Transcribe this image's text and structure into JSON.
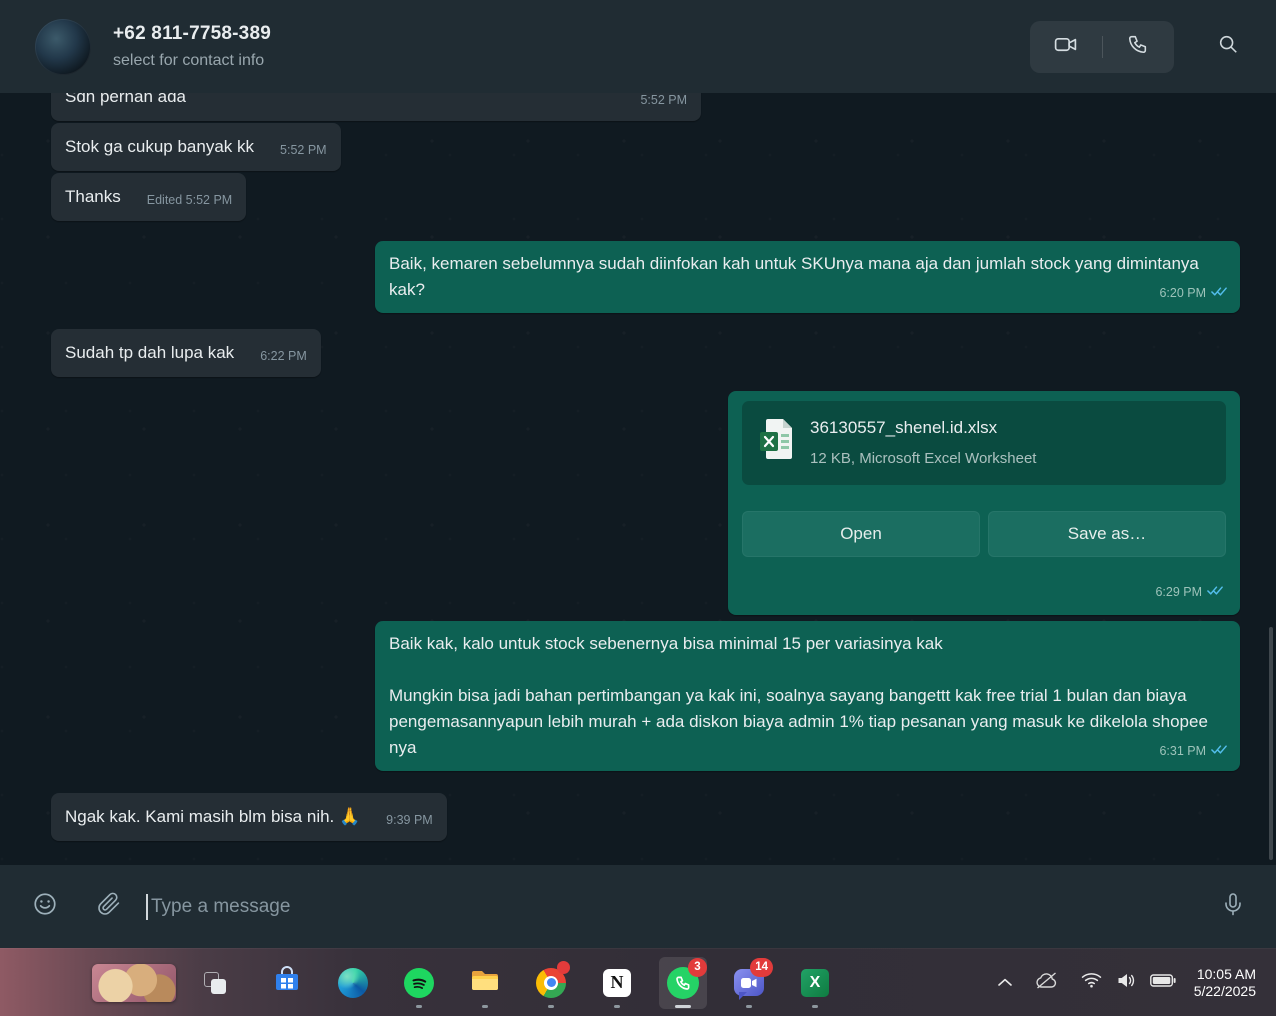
{
  "header": {
    "title": "+62 811-7758-389",
    "subtitle": "select for contact info"
  },
  "messages": [
    {
      "type": "in",
      "text": "Sdh pernah ada",
      "time": "5:52 PM"
    },
    {
      "type": "in",
      "text": "Stok ga cukup banyak kk",
      "time": "5:52 PM"
    },
    {
      "type": "in",
      "text": "Thanks",
      "meta": "Edited 5:52 PM"
    },
    {
      "type": "out",
      "text": "Baik, kemaren sebelumnya sudah diinfokan kah untuk SKUnya mana aja dan jumlah stock yang dimintanya kak?",
      "time": "6:20 PM",
      "status": "read"
    },
    {
      "type": "in",
      "text": "Sudah tp dah lupa kak",
      "time": "6:22 PM"
    },
    {
      "type": "out-file",
      "filename": "36130557_shenel.id.xlsx",
      "filemeta": "12 KB, Microsoft Excel Worksheet",
      "open_label": "Open",
      "saveas_label": "Save as…",
      "time": "6:29 PM",
      "status": "read"
    },
    {
      "type": "out",
      "text1": "Baik kak, kalo untuk stock sebenernya bisa minimal 15 per variasinya kak",
      "text2": "Mungkin bisa jadi bahan pertimbangan ya kak ini, soalnya sayang bangettt kak free trial 1 bulan dan biaya pengemasannyapun lebih murah + ada diskon biaya admin 1% tiap pesanan yang masuk ke dikelola shopee nya",
      "time": "6:31 PM",
      "status": "read"
    },
    {
      "type": "in",
      "text": "Ngak kak. Kami masih blm bisa nih. 🙏",
      "time": "9:39 PM"
    }
  ],
  "composer": {
    "placeholder": "Type a message"
  },
  "taskbar": {
    "badges": {
      "whatsapp": "3",
      "chat": "14"
    },
    "clock": {
      "time": "10:05 AM",
      "date": "5/22/2025"
    },
    "notion_letter": "N",
    "excel_letter": "X"
  },
  "icons": {
    "header": [
      "video-call",
      "voice-call",
      "search"
    ],
    "composer": [
      "emoji",
      "attach",
      "mic"
    ],
    "message": [
      "excel-file",
      "double-check-read"
    ],
    "tray": [
      "chevron-up",
      "onedrive-cloud",
      "wifi",
      "volume",
      "battery"
    ]
  },
  "colors": {
    "header_bg": "#202c33",
    "incoming_bubble": "#252e35",
    "outgoing_bubble": "#0d6153",
    "tick_blue": "#53bdeb",
    "badge_red": "#e23b3b",
    "whatsapp_green": "#25d366"
  }
}
